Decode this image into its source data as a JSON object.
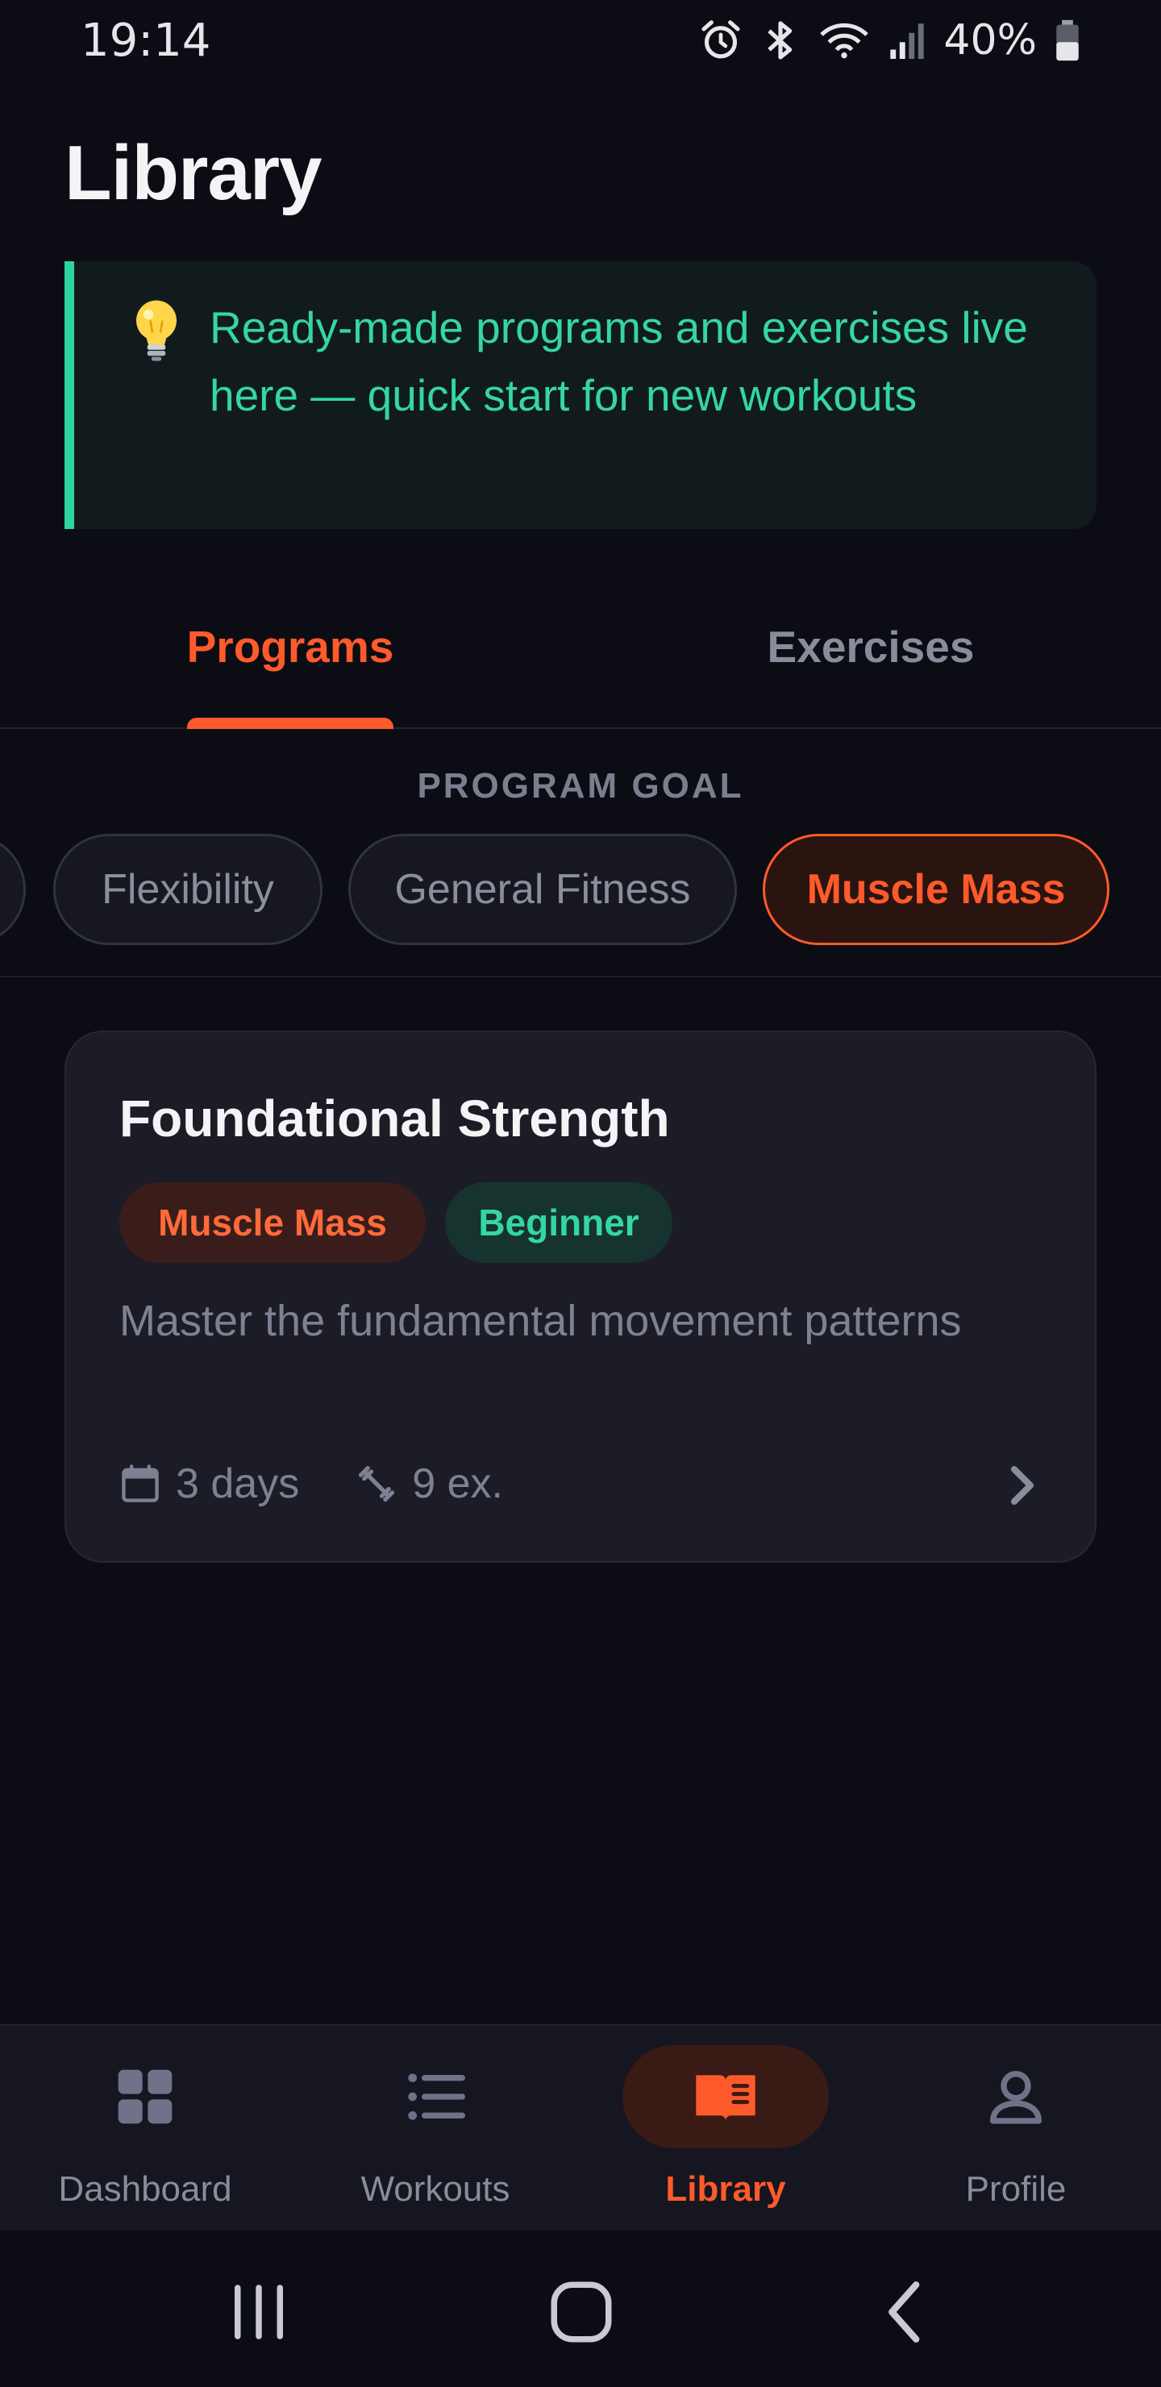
{
  "status_bar": {
    "time": "19:14",
    "battery": "40%",
    "icons": [
      "alarm-icon",
      "bluetooth-icon",
      "wifi-icon",
      "signal-icon",
      "battery-icon"
    ]
  },
  "header": {
    "title": "Library"
  },
  "tip": {
    "icon": "lightbulb-icon",
    "text": "Ready-made programs and exercises live here — quick start for new workouts"
  },
  "tabs": [
    {
      "label": "Programs",
      "active": true
    },
    {
      "label": "Exercises",
      "active": false
    }
  ],
  "filter": {
    "label": "PROGRAM GOAL",
    "chips": [
      {
        "label": "",
        "selected": false
      },
      {
        "label": "Flexibility",
        "selected": false
      },
      {
        "label": "General Fitness",
        "selected": false
      },
      {
        "label": "Muscle Mass",
        "selected": true
      }
    ]
  },
  "programs": [
    {
      "title": "Foundational Strength",
      "goal_tag": "Muscle Mass",
      "level_tag": "Beginner",
      "description": "Master the fundamental movement patterns",
      "days": "3 days",
      "exercises": "9 ex."
    }
  ],
  "bottom_nav": [
    {
      "label": "Dashboard",
      "icon": "dashboard-icon",
      "active": false
    },
    {
      "label": "Workouts",
      "icon": "list-icon",
      "active": false
    },
    {
      "label": "Library",
      "icon": "book-icon",
      "active": true
    },
    {
      "label": "Profile",
      "icon": "profile-icon",
      "active": false
    }
  ],
  "colors": {
    "accent": "#ff5a2b",
    "tip_green": "#2ed3a1",
    "background": "#0c0d14",
    "card": "#1c1c27"
  }
}
